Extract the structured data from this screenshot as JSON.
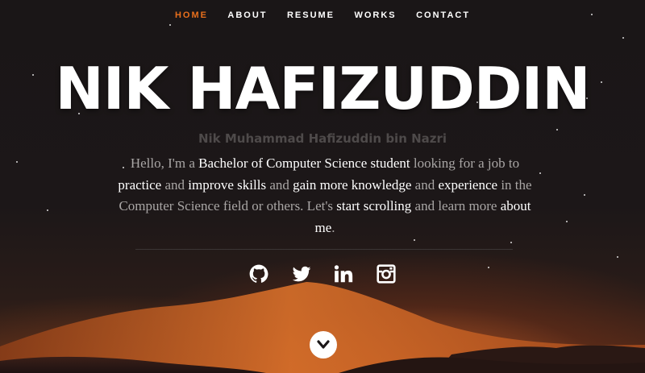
{
  "nav": {
    "items": [
      {
        "label": "HOME",
        "active": true
      },
      {
        "label": "ABOUT",
        "active": false
      },
      {
        "label": "RESUME",
        "active": false
      },
      {
        "label": "WORKS",
        "active": false
      },
      {
        "label": "CONTACT",
        "active": false
      }
    ],
    "active_color": "#e86f1c"
  },
  "hero": {
    "name": "NIK HAFIZUDDIN",
    "full_name": "Nik Muhammad Hafizuddin bin Nazri",
    "intro": [
      {
        "text": "Hello, I'm a ",
        "hl": false
      },
      {
        "text": "Bachelor of Computer Science student",
        "hl": true
      },
      {
        "text": " looking for a job to ",
        "hl": false
      },
      {
        "text": "practice",
        "hl": true
      },
      {
        "text": " and ",
        "hl": false
      },
      {
        "text": "improve skills",
        "hl": true
      },
      {
        "text": " and ",
        "hl": false
      },
      {
        "text": "gain more knowledge",
        "hl": true
      },
      {
        "text": " and ",
        "hl": false
      },
      {
        "text": "experience",
        "hl": true
      },
      {
        "text": " in the Computer Science field or others. Let's ",
        "hl": false
      },
      {
        "text": "start scrolling",
        "hl": true
      },
      {
        "text": " and learn more ",
        "hl": false
      },
      {
        "text": "about me",
        "hl": true
      },
      {
        "text": ".",
        "hl": false
      }
    ]
  },
  "social": {
    "icons": [
      "github-icon",
      "twitter-icon",
      "linkedin-icon",
      "instagram-icon"
    ]
  },
  "scroll_button": {
    "icon": "chevron-down-icon"
  },
  "colors": {
    "accent": "#e86f1c",
    "background": "#1b1718"
  }
}
